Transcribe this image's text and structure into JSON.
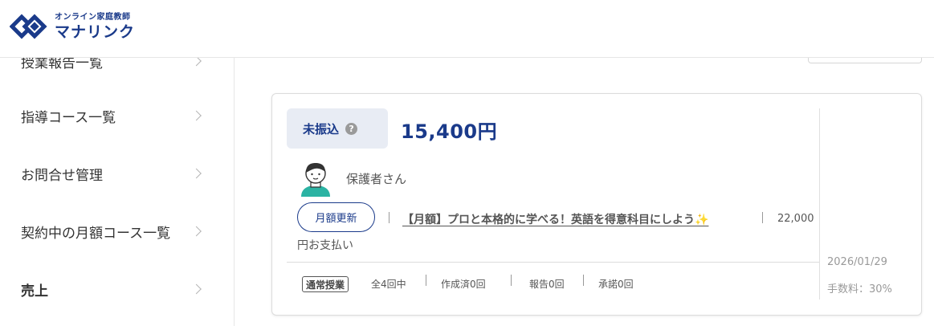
{
  "header": {
    "logo_sub": "オンライン家庭教師",
    "logo_main": "マナリンク"
  },
  "sidebar": {
    "items": [
      {
        "label": "授業報告一覧"
      },
      {
        "label": "指導コース一覧"
      },
      {
        "label": "お問合せ管理"
      },
      {
        "label": "契約中の月額コース一覧"
      },
      {
        "label": "売上"
      }
    ]
  },
  "card": {
    "status": "未振込",
    "help_glyph": "?",
    "amount": "15,400円",
    "guardian": "保護者さん",
    "monthly_button": "月額更新",
    "course_title": "【月額】プロと本格的に学べる！英語を得意科目にしよう",
    "sparkle_glyph": "✨",
    "price_part1": "22,000",
    "price_part2": "円お支払い",
    "lesson_type": "通常授業",
    "stats": {
      "total": "全4回中",
      "created": "作成済0回",
      "reported": "報告0回",
      "approved": "承諾0回"
    },
    "date": "2026/01/29",
    "fee": "手数料：30%"
  },
  "colors": {
    "brand": "#1a3a8a",
    "status_bg": "#e8ecf4",
    "avatar_teal": "#2bb3a3"
  }
}
